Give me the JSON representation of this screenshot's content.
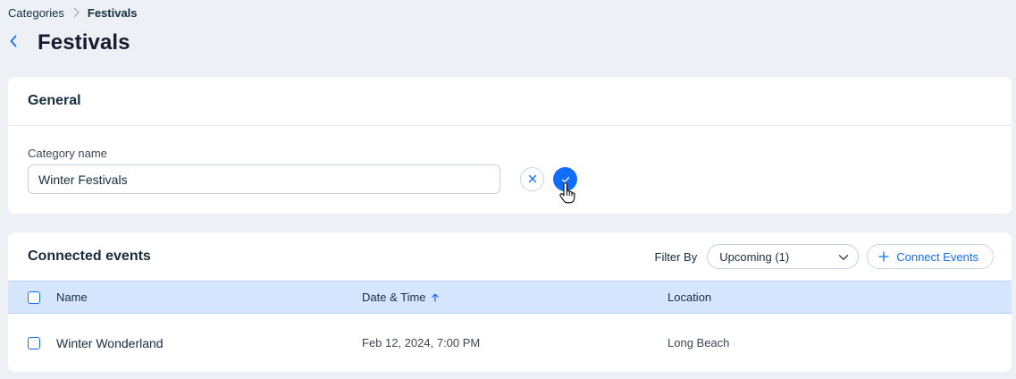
{
  "breadcrumb": {
    "parent": "Categories",
    "current": "Festivals"
  },
  "header": {
    "title": "Festivals"
  },
  "general": {
    "title": "General",
    "field_label": "Category name",
    "field_value": "Winter Festivals"
  },
  "events": {
    "title": "Connected events",
    "filter_label": "Filter By",
    "filter_value": "Upcoming (1)",
    "connect_label": "Connect Events",
    "columns": {
      "name": "Name",
      "date": "Date & Time",
      "location": "Location"
    },
    "rows": [
      {
        "name": "Winter Wonderland",
        "date": "Feb 12, 2024, 7:00 PM",
        "location": "Long Beach"
      }
    ]
  },
  "colors": {
    "accent": "#116dff",
    "background": "#edf0f4",
    "table_header": "#d6e6fe",
    "text": "#162d3d"
  },
  "icons": {
    "breadcrumb_separator": "chevron-right-icon",
    "back": "chevron-left-icon",
    "cancel": "close-icon",
    "confirm": "check-icon",
    "cursor": "hand-pointer-icon",
    "dropdown": "chevron-down-icon",
    "connect": "plus-icon",
    "sort": "arrow-up-icon"
  }
}
